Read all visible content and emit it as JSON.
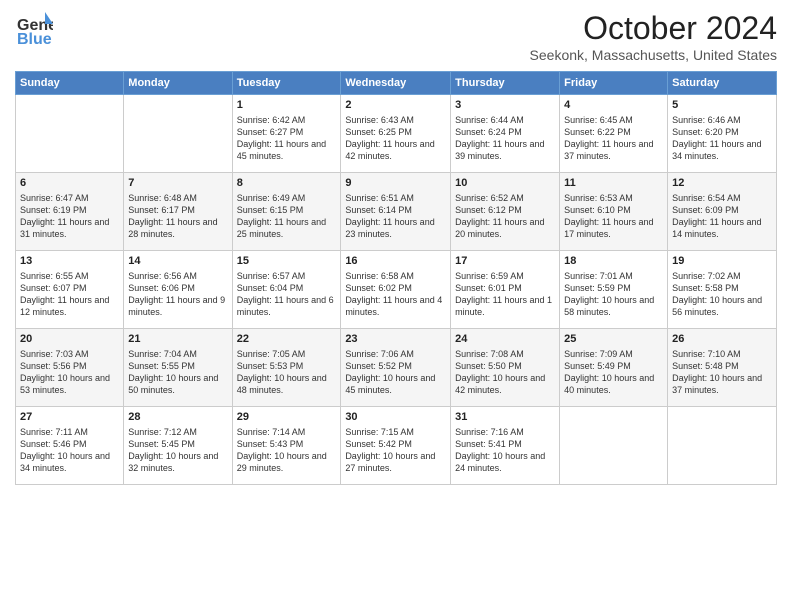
{
  "header": {
    "logo_general": "General",
    "logo_blue": "Blue",
    "month_title": "October 2024",
    "location": "Seekonk, Massachusetts, United States"
  },
  "days_of_week": [
    "Sunday",
    "Monday",
    "Tuesday",
    "Wednesday",
    "Thursday",
    "Friday",
    "Saturday"
  ],
  "weeks": [
    [
      {
        "day": "",
        "info": ""
      },
      {
        "day": "",
        "info": ""
      },
      {
        "day": "1",
        "info": "Sunrise: 6:42 AM\nSunset: 6:27 PM\nDaylight: 11 hours and 45 minutes."
      },
      {
        "day": "2",
        "info": "Sunrise: 6:43 AM\nSunset: 6:25 PM\nDaylight: 11 hours and 42 minutes."
      },
      {
        "day": "3",
        "info": "Sunrise: 6:44 AM\nSunset: 6:24 PM\nDaylight: 11 hours and 39 minutes."
      },
      {
        "day": "4",
        "info": "Sunrise: 6:45 AM\nSunset: 6:22 PM\nDaylight: 11 hours and 37 minutes."
      },
      {
        "day": "5",
        "info": "Sunrise: 6:46 AM\nSunset: 6:20 PM\nDaylight: 11 hours and 34 minutes."
      }
    ],
    [
      {
        "day": "6",
        "info": "Sunrise: 6:47 AM\nSunset: 6:19 PM\nDaylight: 11 hours and 31 minutes."
      },
      {
        "day": "7",
        "info": "Sunrise: 6:48 AM\nSunset: 6:17 PM\nDaylight: 11 hours and 28 minutes."
      },
      {
        "day": "8",
        "info": "Sunrise: 6:49 AM\nSunset: 6:15 PM\nDaylight: 11 hours and 25 minutes."
      },
      {
        "day": "9",
        "info": "Sunrise: 6:51 AM\nSunset: 6:14 PM\nDaylight: 11 hours and 23 minutes."
      },
      {
        "day": "10",
        "info": "Sunrise: 6:52 AM\nSunset: 6:12 PM\nDaylight: 11 hours and 20 minutes."
      },
      {
        "day": "11",
        "info": "Sunrise: 6:53 AM\nSunset: 6:10 PM\nDaylight: 11 hours and 17 minutes."
      },
      {
        "day": "12",
        "info": "Sunrise: 6:54 AM\nSunset: 6:09 PM\nDaylight: 11 hours and 14 minutes."
      }
    ],
    [
      {
        "day": "13",
        "info": "Sunrise: 6:55 AM\nSunset: 6:07 PM\nDaylight: 11 hours and 12 minutes."
      },
      {
        "day": "14",
        "info": "Sunrise: 6:56 AM\nSunset: 6:06 PM\nDaylight: 11 hours and 9 minutes."
      },
      {
        "day": "15",
        "info": "Sunrise: 6:57 AM\nSunset: 6:04 PM\nDaylight: 11 hours and 6 minutes."
      },
      {
        "day": "16",
        "info": "Sunrise: 6:58 AM\nSunset: 6:02 PM\nDaylight: 11 hours and 4 minutes."
      },
      {
        "day": "17",
        "info": "Sunrise: 6:59 AM\nSunset: 6:01 PM\nDaylight: 11 hours and 1 minute."
      },
      {
        "day": "18",
        "info": "Sunrise: 7:01 AM\nSunset: 5:59 PM\nDaylight: 10 hours and 58 minutes."
      },
      {
        "day": "19",
        "info": "Sunrise: 7:02 AM\nSunset: 5:58 PM\nDaylight: 10 hours and 56 minutes."
      }
    ],
    [
      {
        "day": "20",
        "info": "Sunrise: 7:03 AM\nSunset: 5:56 PM\nDaylight: 10 hours and 53 minutes."
      },
      {
        "day": "21",
        "info": "Sunrise: 7:04 AM\nSunset: 5:55 PM\nDaylight: 10 hours and 50 minutes."
      },
      {
        "day": "22",
        "info": "Sunrise: 7:05 AM\nSunset: 5:53 PM\nDaylight: 10 hours and 48 minutes."
      },
      {
        "day": "23",
        "info": "Sunrise: 7:06 AM\nSunset: 5:52 PM\nDaylight: 10 hours and 45 minutes."
      },
      {
        "day": "24",
        "info": "Sunrise: 7:08 AM\nSunset: 5:50 PM\nDaylight: 10 hours and 42 minutes."
      },
      {
        "day": "25",
        "info": "Sunrise: 7:09 AM\nSunset: 5:49 PM\nDaylight: 10 hours and 40 minutes."
      },
      {
        "day": "26",
        "info": "Sunrise: 7:10 AM\nSunset: 5:48 PM\nDaylight: 10 hours and 37 minutes."
      }
    ],
    [
      {
        "day": "27",
        "info": "Sunrise: 7:11 AM\nSunset: 5:46 PM\nDaylight: 10 hours and 34 minutes."
      },
      {
        "day": "28",
        "info": "Sunrise: 7:12 AM\nSunset: 5:45 PM\nDaylight: 10 hours and 32 minutes."
      },
      {
        "day": "29",
        "info": "Sunrise: 7:14 AM\nSunset: 5:43 PM\nDaylight: 10 hours and 29 minutes."
      },
      {
        "day": "30",
        "info": "Sunrise: 7:15 AM\nSunset: 5:42 PM\nDaylight: 10 hours and 27 minutes."
      },
      {
        "day": "31",
        "info": "Sunrise: 7:16 AM\nSunset: 5:41 PM\nDaylight: 10 hours and 24 minutes."
      },
      {
        "day": "",
        "info": ""
      },
      {
        "day": "",
        "info": ""
      }
    ]
  ]
}
